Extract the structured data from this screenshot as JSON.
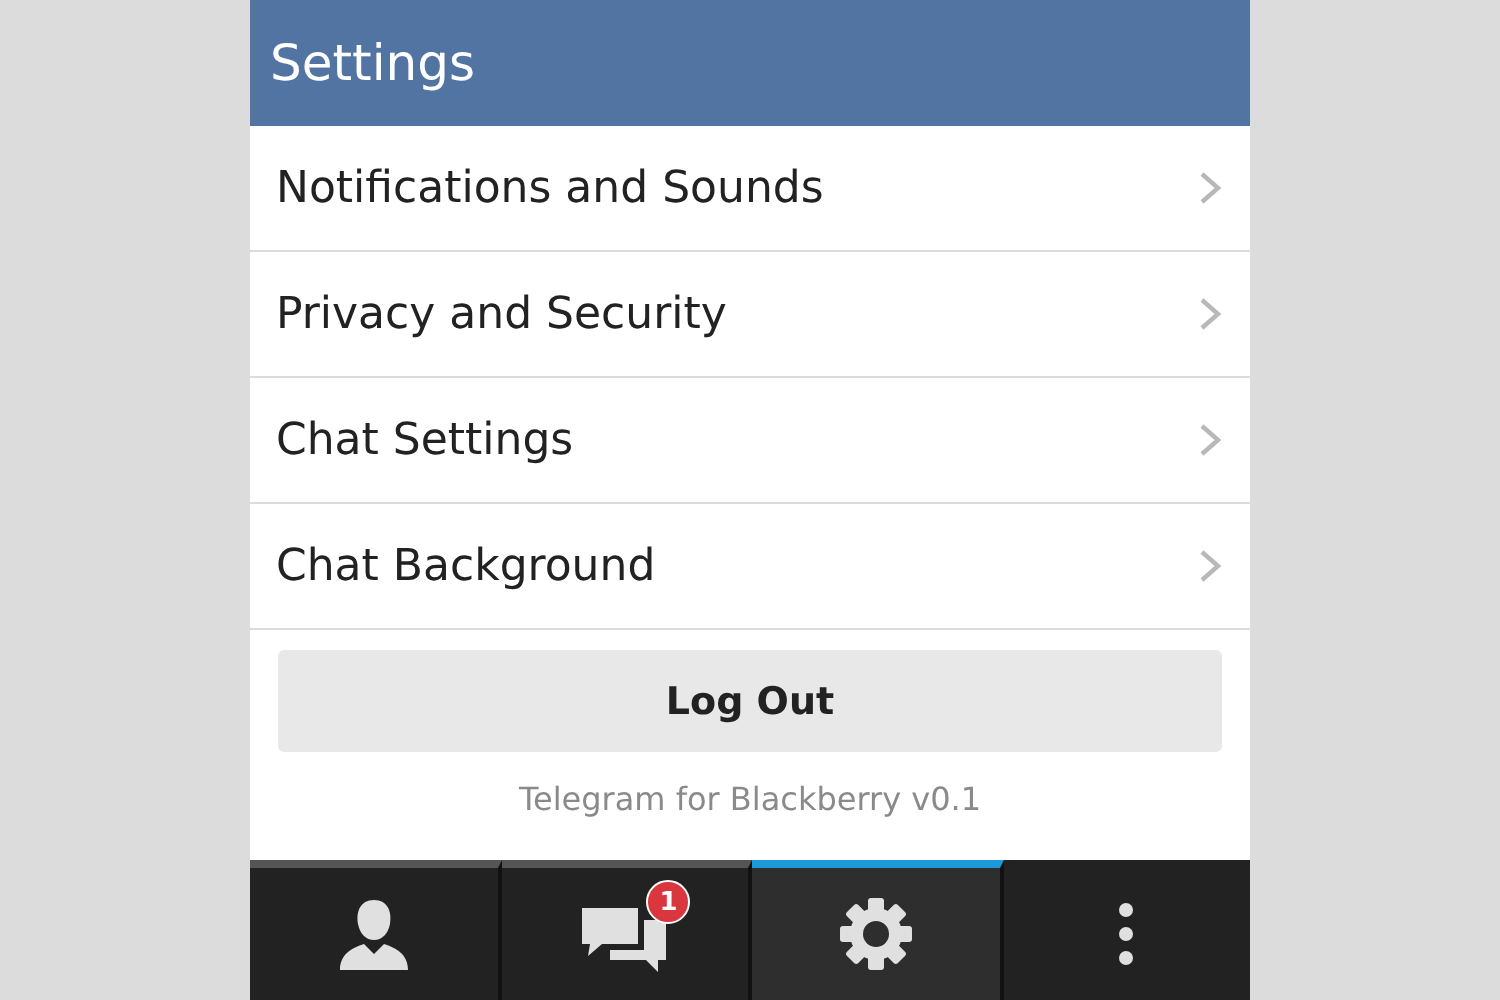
{
  "header": {
    "title": "Settings"
  },
  "settings_items": [
    {
      "label": "Notifications and Sounds"
    },
    {
      "label": "Privacy and Security"
    },
    {
      "label": "Chat Settings"
    },
    {
      "label": "Chat Background"
    }
  ],
  "logout_button": "Log Out",
  "version": "Telegram for Blackberry v0.1",
  "tabs": [
    {
      "kind": "contacts",
      "selected": false
    },
    {
      "kind": "chats",
      "selected": false,
      "badge": "1"
    },
    {
      "kind": "settings",
      "selected": true
    },
    {
      "kind": "menu",
      "selected": false
    }
  ]
}
